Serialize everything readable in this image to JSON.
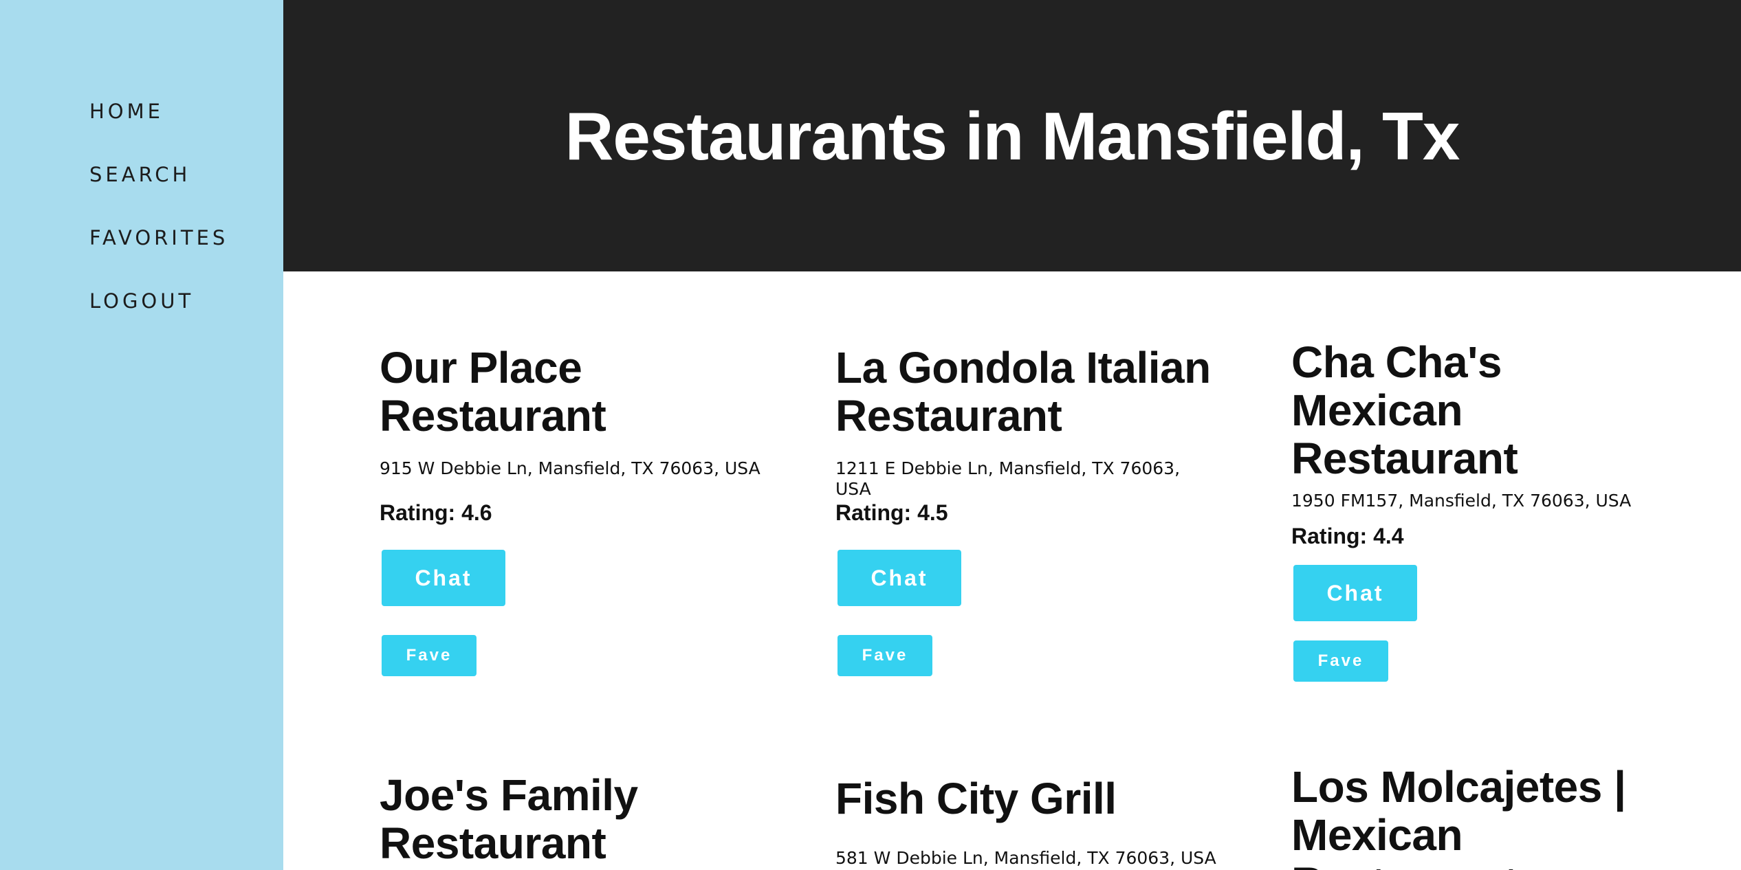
{
  "nav": {
    "home": "HOME",
    "search": "SEARCH",
    "favorites": "FAVORITES",
    "logout": "LOGOUT"
  },
  "header": {
    "title": "Restaurants in Mansfield, Tx"
  },
  "restaurants": [
    {
      "name_line1": "Our Place",
      "name_line2": "Restaurant",
      "address": "915 W Debbie Ln, Mansfield, TX 76063, USA",
      "rating": "Rating: 4.6",
      "chat_label": "Chat",
      "fave_label": "Fave"
    },
    {
      "name_line1": "La Gondola Italian",
      "name_line2": "Restaurant",
      "address": "1211 E Debbie Ln, Mansfield, TX 76063, USA",
      "rating": "Rating: 4.5",
      "chat_label": "Chat",
      "fave_label": "Fave"
    },
    {
      "name_line1": "Cha Cha's",
      "name_line2": "Mexican",
      "name_line3": "Restaurant",
      "address": "1950 FM157, Mansfield, TX 76063, USA",
      "rating": "Rating: 4.4",
      "chat_label": "Chat",
      "fave_label": "Fave"
    },
    {
      "name_line1": "Joe's Family",
      "name_line2": "Restaurant"
    },
    {
      "name_line1": "Fish City Grill",
      "address": "581 W Debbie Ln, Mansfield, TX 76063, USA"
    },
    {
      "name_line1": "Los Molcajetes |",
      "name_line2": "Mexican",
      "name_line3": "Restaurant"
    }
  ]
}
